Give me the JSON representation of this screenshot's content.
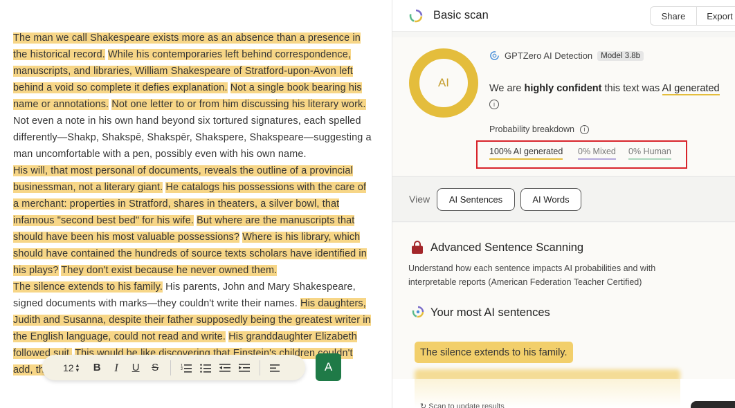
{
  "editor": {
    "paragraphs": [
      [
        {
          "t": "The man we call Shakespeare exists more as an absence than a presence in the historical record.",
          "hl": true
        },
        {
          "t": "While his contemporaries left behind correspondence, manuscripts, and libraries, William Shakespeare of Stratford-upon-Avon left behind a void so complete it defies explanation.",
          "hl": true
        },
        {
          "t": "Not a single book bearing his name or annotations.",
          "hl": true
        },
        {
          "t": "Not one letter to or from him discussing his literary work.",
          "hl": true
        },
        {
          "t": "Not even a note in his own hand beyond six tortured signatures, each spelled differently—Shakp, Shakspē, Shakspēr, Shakspere, Shakspeare—suggesting a man uncomfortable with a pen, possibly even with his own name.",
          "hl": false
        }
      ],
      [
        {
          "t": "His will, that most personal of documents, reveals the outline of a provincial businessman, not a literary giant.",
          "hl": true
        },
        {
          "t": "He catalogs his possessions with the care of a merchant: properties in Stratford, shares in theaters, a silver bowl, that infamous \"second best bed\" for his wife.",
          "hl": true
        },
        {
          "t": "But where are the manuscripts that should have been his most valuable possessions?",
          "hl": true
        },
        {
          "t": "Where is his library, which should have contained the hundreds of source texts scholars have identified in his plays?",
          "hl": true
        },
        {
          "t": "They don't exist because he never owned them.",
          "hl": true
        }
      ],
      [
        {
          "t": "The silence extends to his family.",
          "hl": true
        },
        {
          "t": "His parents, John and Mary Shakespeare, signed documents with marks—they couldn't write their names.",
          "hl": false
        },
        {
          "t": "His daughters, Judith and Susanna, despite their father supposedly being the greatest writer in the English language, could not read and write.",
          "hl": true
        },
        {
          "t": "His granddaughter Elizabeth followed suit.",
          "hl": true
        },
        {
          "t": "This would be like discovering that Einstein's children couldn't add, that Mozart's daughters had never",
          "hl": true
        }
      ]
    ],
    "toolbar": {
      "font_size": "12",
      "bold": "B",
      "italic": "I",
      "underline": "U",
      "strike": "S",
      "ordered_list": "≔",
      "bullet_list": "☰",
      "outdent": "⇤",
      "indent": "⇥",
      "align": "☰"
    },
    "grammar_glyph": "A"
  },
  "panel": {
    "title": "Basic scan",
    "share_label": "Share",
    "export_label": "Export",
    "ring_label": "AI",
    "detector_name": "GPTZero AI Detection",
    "model_badge": "Model 3.8b",
    "verdict_prefix": "We are ",
    "verdict_strong": "highly confident",
    "verdict_mid": " this text was ",
    "verdict_ai": "AI generated",
    "info_glyph": "i",
    "probability_label": "Probability breakdown",
    "prob_ai": "100% AI generated",
    "prob_mixed": "0% Mixed",
    "prob_human": "0% Human",
    "view_label": "View",
    "view_ai_sentences": "AI Sentences",
    "view_ai_words": "AI Words",
    "advanced_title": "Advanced Sentence Scanning",
    "advanced_desc": "Understand how each sentence impacts AI probabilities and with interpretable reports (American Federation Teacher Certified)",
    "sentences_title": "Your most AI sentences",
    "top_sentence": "The silence extends to his family.",
    "scan_note": "↻  Scan to update results"
  },
  "colors": {
    "highlight": "#f7d687",
    "ai_accent": "#e4bd3c",
    "mixed": "#b3a8dc",
    "human": "#a9d6bc",
    "grammar_green": "#1f7a47",
    "callout_red": "#d8232a"
  },
  "icons": {
    "logo": "gptzero-ring-logo-icon",
    "detector": "gptzero-small-icon",
    "lock": "lock-icon",
    "sentences": "sentences-ring-icon",
    "info": "info-icon"
  }
}
